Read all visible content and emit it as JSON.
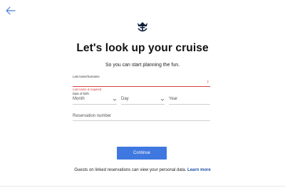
{
  "title": "Let's look up your cruise",
  "subtitle": "So you can start planning the fun.",
  "form": {
    "last_name_label": "Last name/Surname",
    "last_name_value": "",
    "error_icon": "!",
    "last_name_error": "Last name is required",
    "dob_label": "Date of birth",
    "month_placeholder": "Month",
    "day_placeholder": "Day",
    "year_placeholder": "Year",
    "reservation_placeholder": "Reservation number"
  },
  "continue_label": "Continue",
  "footer": {
    "text": "Guests on linked reservations can view your personal data.",
    "link": "Learn more"
  },
  "colors": {
    "accent": "#3f78e0",
    "error": "#d63c3c",
    "link": "#1d4fa8"
  },
  "icons": [
    "back-arrow-icon",
    "crown-anchor-logo",
    "chevron-down-icon",
    "error-icon"
  ]
}
